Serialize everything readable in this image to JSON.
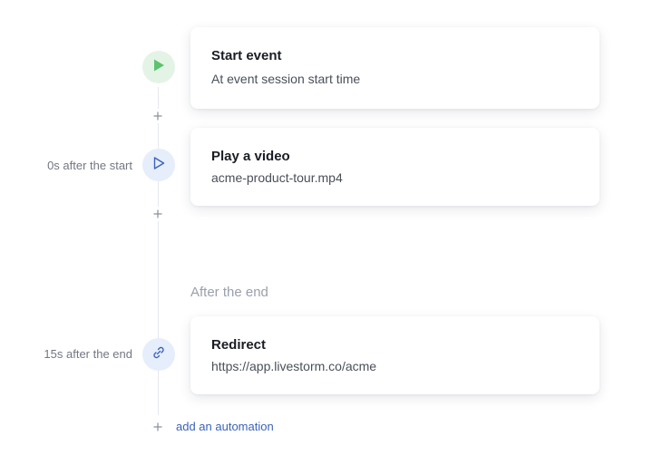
{
  "timeline": {
    "steps": [
      {
        "title": "Start event",
        "subtitle": "At event session start time",
        "side_label": "",
        "icon": "play-filled-icon"
      },
      {
        "title": "Play a video",
        "subtitle": "acme-product-tour.mp4",
        "side_label": "0s after the start",
        "icon": "play-outline-icon"
      },
      {
        "title": "Redirect",
        "subtitle": "https://app.livestorm.co/acme",
        "side_label": "15s after the end",
        "icon": "link-icon"
      }
    ],
    "section_heading": "After the end",
    "add_label": "add an automation"
  },
  "colors": {
    "start_icon": "#5cc36f",
    "video_icon": "#3a63b8",
    "link_icon": "#3a63b8",
    "link_text": "#3a63b8"
  }
}
